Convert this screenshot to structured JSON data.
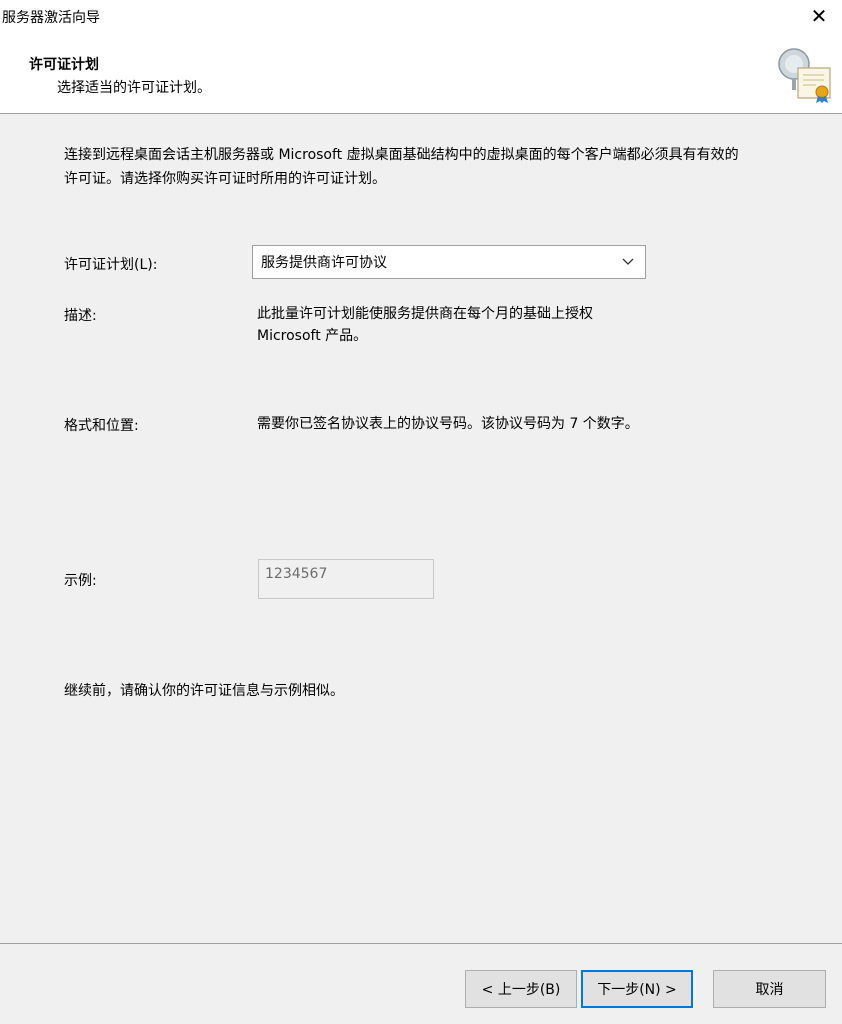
{
  "window": {
    "title": "服务器激活向导",
    "close_glyph": "✕"
  },
  "header": {
    "title": "许可证计划",
    "subtitle": "选择适当的许可证计划。",
    "icon": "certificate-icon"
  },
  "intro": "连接到远程桌面会话主机服务器或 Microsoft 虚拟桌面基础结构中的虚拟桌面的每个客户端都必须具有有效的许可证。请选择你购买许可证时所用的许可证计划。",
  "license_plan": {
    "label": "许可证计划(L):",
    "selected": "服务提供商许可协议"
  },
  "description": {
    "label": "描述:",
    "text": "此批量许可计划能使服务提供商在每个月的基础上授权 Microsoft 产品。"
  },
  "format": {
    "label": "格式和位置:",
    "text": "需要你已签名协议表上的协议号码。该协议号码为 7 个数字。"
  },
  "example": {
    "label": "示例:",
    "value": "1234567"
  },
  "confirm_note": "继续前，请确认你的许可证信息与示例相似。",
  "buttons": {
    "back": "< 上一步(B)",
    "next": "下一步(N) >",
    "cancel": "取消"
  },
  "colors": {
    "accent": "#0078d7",
    "background": "#f0f0f0"
  }
}
